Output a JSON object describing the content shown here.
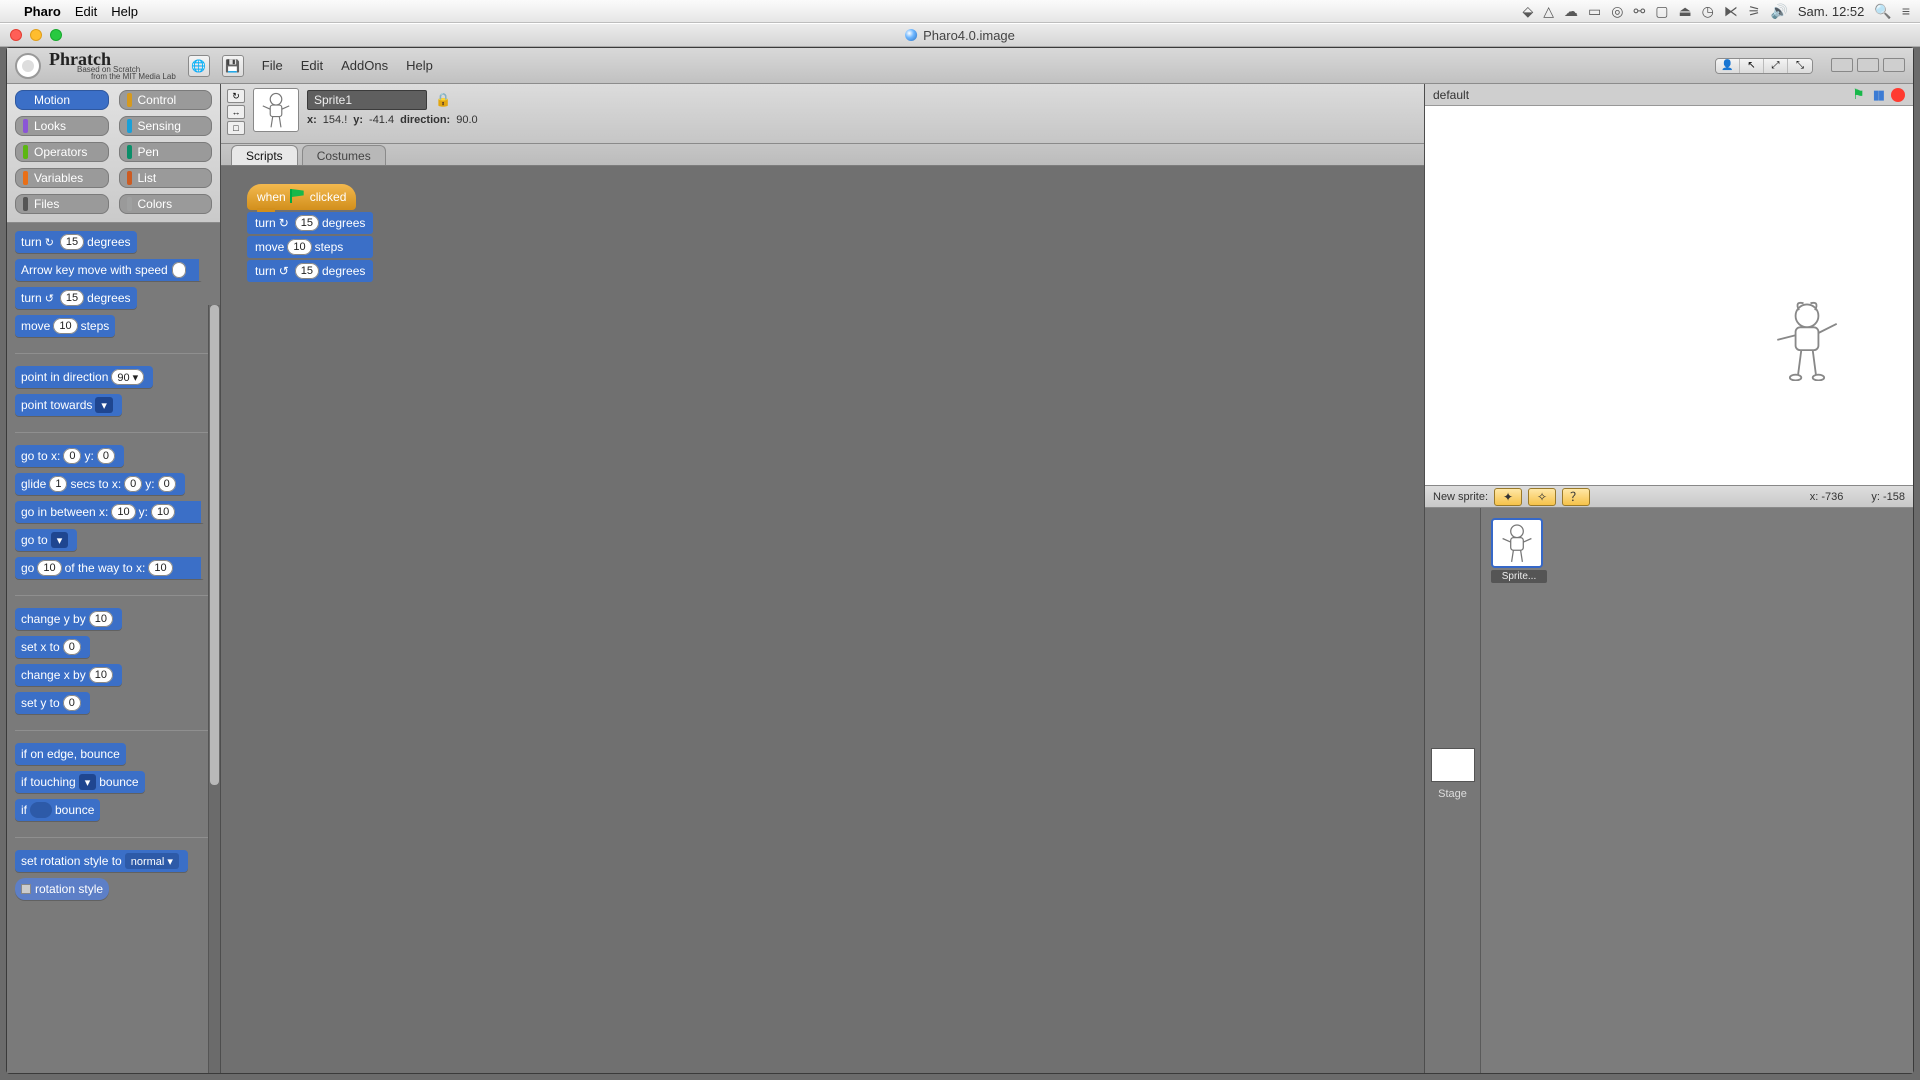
{
  "mac_menu": {
    "app": "Pharo",
    "items": [
      "Edit",
      "Help"
    ],
    "clock": "Sam. 12:52"
  },
  "window": {
    "title": "Pharo4.0.image"
  },
  "app": {
    "name": "Phratch",
    "subtitle1": "Based on Scratch",
    "subtitle2": "from the MIT Media Lab",
    "header_menu": [
      "File",
      "Edit",
      "AddOns",
      "Help"
    ]
  },
  "categories": [
    {
      "label": "Motion",
      "color": "#3b6fc7",
      "selected": true
    },
    {
      "label": "Control",
      "color": "#d69a1e"
    },
    {
      "label": "Looks",
      "color": "#8b55d7"
    },
    {
      "label": "Sensing",
      "color": "#1aa0d8"
    },
    {
      "label": "Operators",
      "color": "#5cb712"
    },
    {
      "label": "Pen",
      "color": "#0b8e69"
    },
    {
      "label": "Variables",
      "color": "#e96f17"
    },
    {
      "label": "List",
      "color": "#cc5b22"
    },
    {
      "label": "Files",
      "color": "#555555"
    },
    {
      "label": "Colors",
      "color": "#9fa0a0"
    }
  ],
  "palette": {
    "turn_cw": {
      "pre": "turn",
      "val": "15",
      "post": "degrees"
    },
    "arrow_move": {
      "pre": "Arrow key move with speed",
      "val": ""
    },
    "turn_ccw": {
      "pre": "turn",
      "val": "15",
      "post": "degrees"
    },
    "move": {
      "pre": "move",
      "val": "10",
      "post": "steps"
    },
    "point_dir": {
      "pre": "point in direction",
      "val": "90 ▾"
    },
    "point_towards": {
      "pre": "point towards",
      "dd": " "
    },
    "go_to_xy": {
      "pre": "go to x:",
      "x": "0",
      "mid": "y:",
      "y": "0"
    },
    "glide": {
      "pre": "glide",
      "s": "1",
      "mid1": "secs to x:",
      "x": "0",
      "mid2": "y:",
      "y": "0"
    },
    "go_between": {
      "pre": "go in between x:",
      "x": "10",
      "mid": "y:",
      "y": "10"
    },
    "go_to": {
      "pre": "go to",
      "dd": " "
    },
    "go_way": {
      "pre": "go",
      "a": "10",
      "mid": "of the way to x:",
      "b": "10"
    },
    "change_y": {
      "pre": "change y by",
      "val": "10"
    },
    "set_x": {
      "pre": "set x to",
      "val": "0"
    },
    "change_x": {
      "pre": "change x by",
      "val": "10"
    },
    "set_y": {
      "pre": "set y to",
      "val": "0"
    },
    "edge_bounce": {
      "label": "if on edge, bounce"
    },
    "touch_bounce": {
      "pre": "if touching",
      "dd": " ",
      "post": "bounce"
    },
    "if_bounce": {
      "pre": "if",
      "post": "bounce"
    },
    "rot_style": {
      "pre": "set rotation style to",
      "val": "normal ▾"
    },
    "rot_rep": {
      "label": "rotation style"
    }
  },
  "sprite": {
    "name": "Sprite1",
    "x_label": "x:",
    "x_val": "154.!",
    "y_label": "y:",
    "y_val": "-41.4",
    "dir_label": "direction:",
    "dir_val": "90.0"
  },
  "tabs": {
    "scripts": "Scripts",
    "costumes": "Costumes"
  },
  "script": {
    "hat_pre": "when",
    "hat_post": "clicked",
    "b1_pre": "turn",
    "b1_val": "15",
    "b1_post": "degrees",
    "b2_pre": "move",
    "b2_val": "10",
    "b2_post": "steps",
    "b3_pre": "turn",
    "b3_val": "15",
    "b3_post": "degrees"
  },
  "stage": {
    "name": "default",
    "new_sprite_label": "New sprite:",
    "x_label": "x:",
    "x_val": "-736",
    "y_label": "y:",
    "y_val": "-158",
    "stage_label": "Stage",
    "sprite_card": "Sprite..."
  }
}
